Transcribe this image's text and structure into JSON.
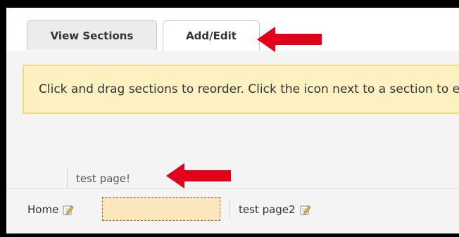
{
  "tabs": {
    "view_sections": "View Sections",
    "add_edit": "Add/Edit"
  },
  "notice_text": "Click and drag sections to reorder. Click the icon next to a section to edit it.",
  "dragging_item": "test page!",
  "sections": {
    "home": "Home",
    "page2": "test page2"
  },
  "colors": {
    "notice_bg": "#fdf1c2",
    "notice_border": "#f1dc7a",
    "placeholder_border": "#d05a1a",
    "arrow": "#e3001b"
  }
}
